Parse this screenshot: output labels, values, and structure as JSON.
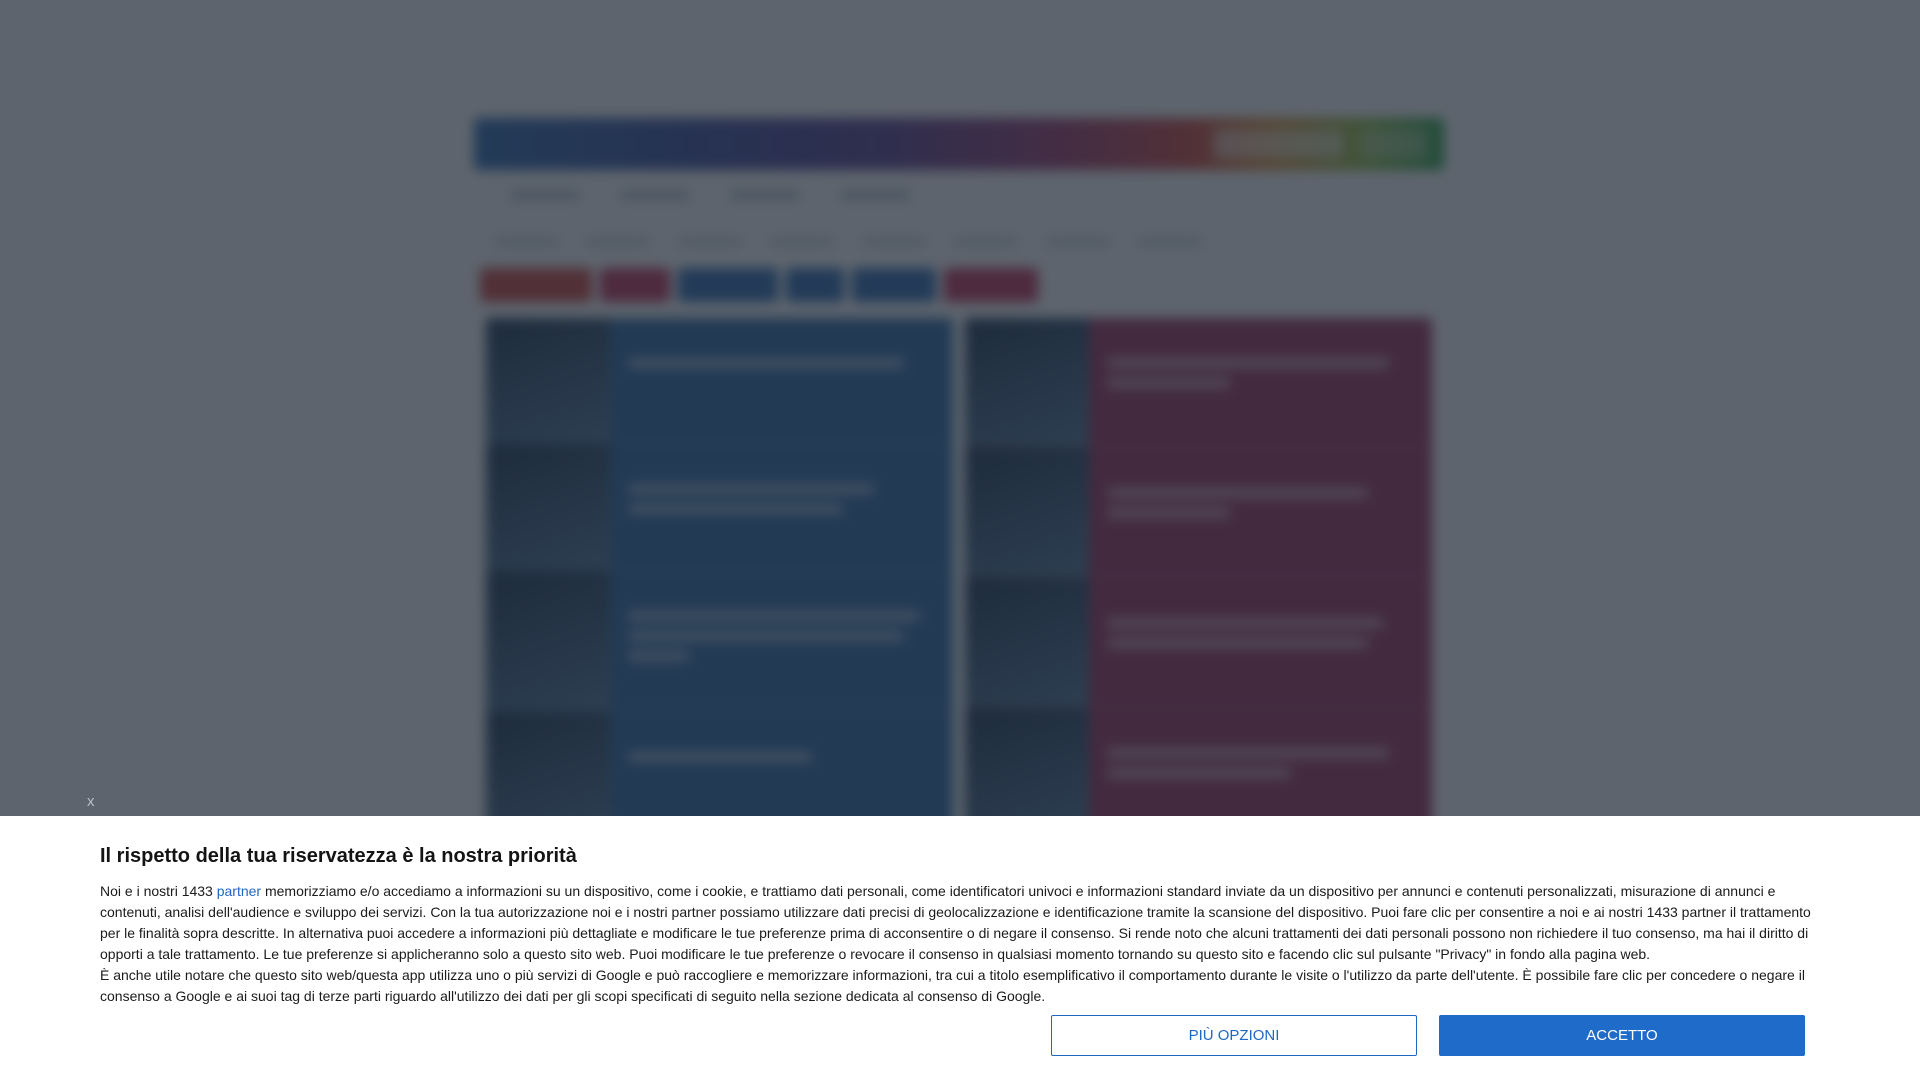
{
  "consent": {
    "close_label": "x",
    "title": "Il rispetto della tua riservatezza è la nostra priorità",
    "paragraph1_before_link": "Noi e i nostri 1433 ",
    "partner_link_label": "partner",
    "paragraph1_after_link": " memorizziamo e/o accediamo a informazioni su un dispositivo, come i cookie, e trattiamo dati personali, come identificatori univoci e informazioni standard inviate da un dispositivo per annunci e contenuti personalizzati, misurazione di annunci e contenuti, analisi dell'audience e sviluppo dei servizi. Con la tua autorizzazione noi e i nostri partner possiamo utilizzare dati precisi di geolocalizzazione e identificazione tramite la scansione del dispositivo. Puoi fare clic per consentire a noi e ai nostri 1433 partner il trattamento per le finalità sopra descritte. In alternativa puoi accedere a informazioni più dettagliate e modificare le tue preferenze prima di acconsentire o di negare il consenso. Si rende noto che alcuni trattamenti dei dati personali possono non richiedere il tuo consenso, ma hai il diritto di opporti a tale trattamento. Le tue preferenze si applicheranno solo a questo sito web. Puoi modificare le tue preferenze o revocare il consenso in qualsiasi momento tornando su questo sito e facendo clic sul pulsante \"Privacy\" in fondo alla pagina web.",
    "paragraph2": "È anche utile notare che questo sito web/questa app utilizza uno o più servizi di Google e può raccogliere e memorizzare informazioni, tra cui a titolo esemplificativo il comportamento durante le visite o l'utilizzo da parte dell'utente. È possibile fare clic per concedere o negare il consenso a Google e ai suoi tag di terze parti riguardo all'utilizzo dei dati per gli scopi specificati di seguito nella sezione dedicata al consenso di Google.",
    "more_options_label": "PIÙ OPZIONI",
    "accept_label": "ACCETTO"
  },
  "colors": {
    "overlay": "#1e2834",
    "accent_blue": "#1f6bc9",
    "link_blue": "#1f67c4",
    "site_blue_column": "#2e6aa6",
    "site_red_column": "#a2305c"
  }
}
